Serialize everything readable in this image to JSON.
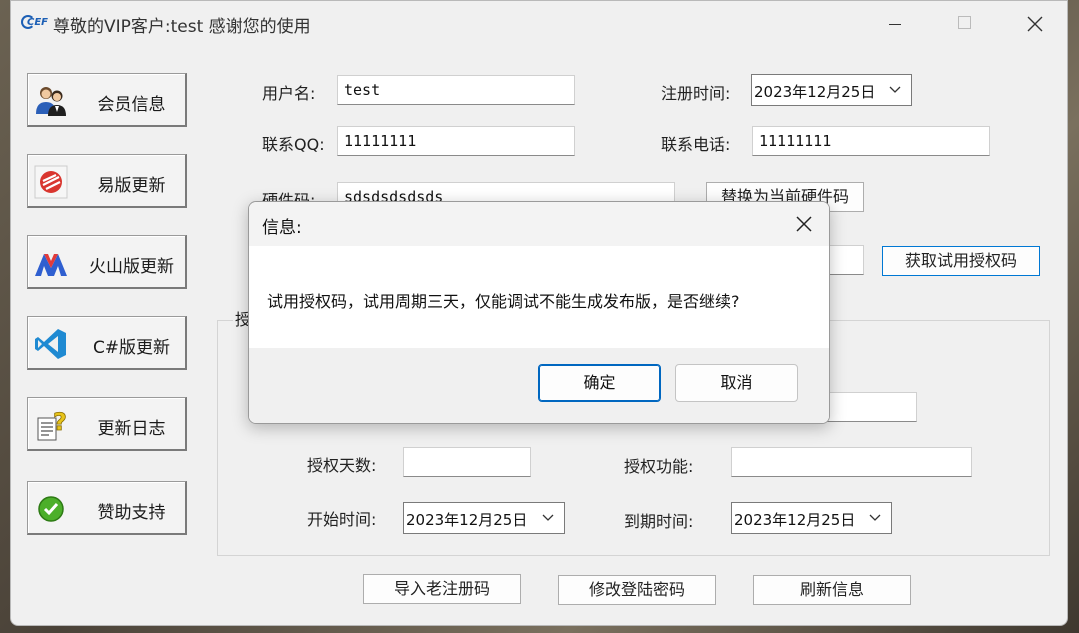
{
  "window": {
    "title": "尊敬的VIP客户:test 感谢您的使用",
    "icon_text": "CEF"
  },
  "sidebar": {
    "items": [
      {
        "label": "会员信息",
        "icon": "users-icon"
      },
      {
        "label": "易版更新",
        "icon": "yi-logo-icon"
      },
      {
        "label": "火山版更新",
        "icon": "volcano-logo-icon"
      },
      {
        "label": "C#版更新",
        "icon": "vscode-icon"
      },
      {
        "label": "更新日志",
        "icon": "question-document-icon"
      },
      {
        "label": "赞助支持",
        "icon": "check-circle-icon"
      }
    ]
  },
  "form": {
    "username_label": "用户名:",
    "username_value": "test",
    "reg_time_label": "注册时间:",
    "reg_time_value": "2023年12月25日",
    "qq_label": "联系QQ:",
    "qq_value": "11111111",
    "phone_label": "联系电话:",
    "phone_value": "11111111",
    "hwid_label": "硬件码:",
    "hwid_value": "sdsdsdsdsds",
    "replace_hwid_button": "替换为当前硬件码",
    "get_trial_button": "获取试用授权码",
    "group_label": "授"
  },
  "auth": {
    "days_label": "授权天数:",
    "days_value": "",
    "function_label": "授权功能:",
    "function_value": "",
    "start_label": "开始时间:",
    "start_value": "2023年12月25日",
    "end_label": "到期时间:",
    "end_value": "2023年12月25日"
  },
  "bottom": {
    "import_button": "导入老注册码",
    "change_pwd_button": "修改登陆密码",
    "refresh_button": "刷新信息"
  },
  "dialog": {
    "title": "信息:",
    "message": "试用授权码，试用周期三天，仅能调试不能生成发布版，是否继续?",
    "ok_label": "确定",
    "cancel_label": "取消"
  },
  "colors": {
    "accent": "#0078d4",
    "window_bg": "#f0f0f0"
  }
}
